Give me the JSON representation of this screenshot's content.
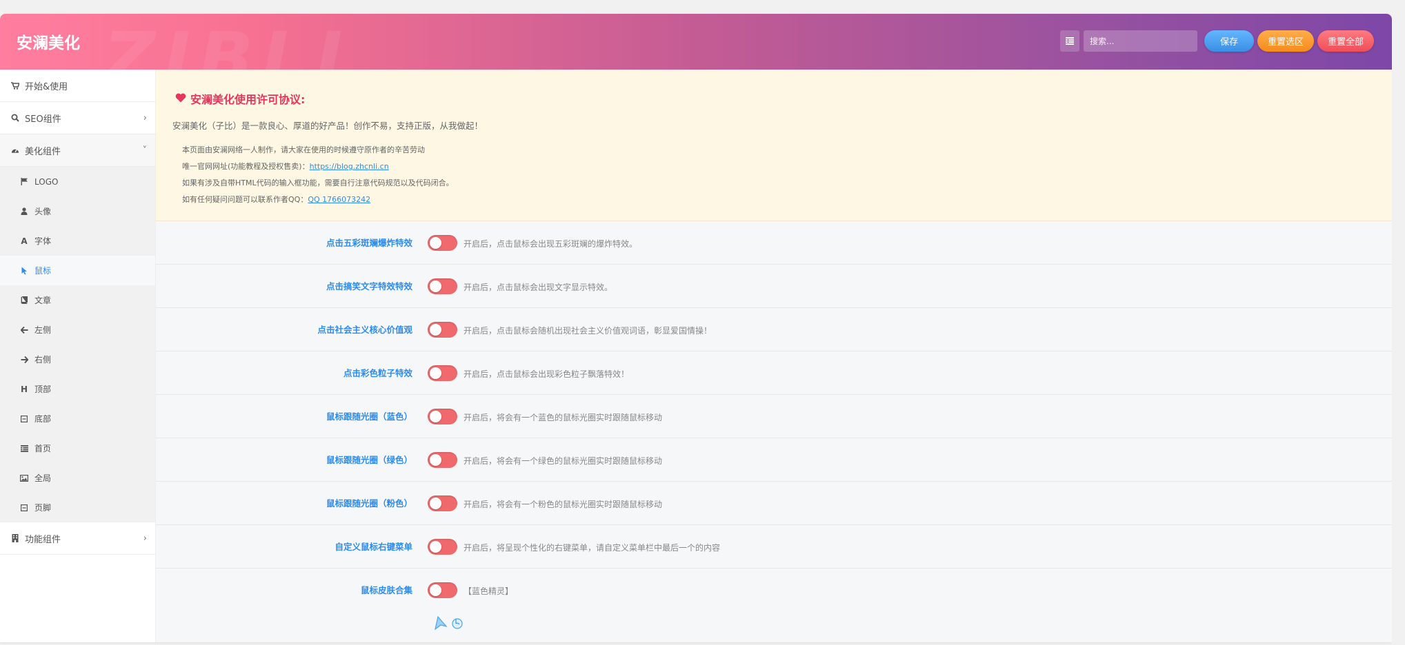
{
  "header": {
    "title": "安澜美化",
    "watermark": "ZIBLL",
    "search_placeholder": "搜索...",
    "save_label": "保存",
    "reset_section_label": "重置选区",
    "reset_all_label": "重置全部"
  },
  "sidebar": {
    "top_items": [
      {
        "label": "开始&使用",
        "icon": "cart-icon"
      },
      {
        "label": "SEO组件",
        "icon": "search-icon",
        "chevron": "›"
      },
      {
        "label": "美化组件",
        "icon": "dashboard-icon",
        "chevron": "˅"
      }
    ],
    "sub_items": [
      {
        "label": "LOGO",
        "icon": "flag-icon"
      },
      {
        "label": "头像",
        "icon": "user-icon"
      },
      {
        "label": "字体",
        "icon": "font-icon",
        "glyph": "A"
      },
      {
        "label": "鼠标",
        "icon": "cursor-icon",
        "active": true
      },
      {
        "label": "文章",
        "icon": "book-icon"
      },
      {
        "label": "左侧",
        "icon": "arrow-left-icon"
      },
      {
        "label": "右侧",
        "icon": "arrow-right-icon"
      },
      {
        "label": "顶部",
        "icon": "header-icon",
        "glyph": "H"
      },
      {
        "label": "底部",
        "icon": "minus-square-icon"
      },
      {
        "label": "首页",
        "icon": "list-icon"
      },
      {
        "label": "全局",
        "icon": "image-icon"
      },
      {
        "label": "页脚",
        "icon": "minus-square-icon"
      }
    ],
    "bottom_items": [
      {
        "label": "功能组件",
        "icon": "building-icon",
        "chevron": "›"
      }
    ]
  },
  "notice": {
    "title": "安澜美化使用许可协议:",
    "intro": "安澜美化（子比）是一款良心、厚道的好产品！创作不易，支持正版，从我做起！",
    "line1": "本页面由安澜网络一人制作，请大家在使用的时候遵守原作者的辛苦劳动",
    "line2_prefix": "唯一官网网址(功能教程及授权售卖)：",
    "line2_link": "https://blog.zhcnli.cn",
    "line3": "如果有涉及自带HTML代码的输入框功能，需要自行注意代码规范以及代码闭合。",
    "line4_prefix": "如有任何疑问问题可以联系作者QQ：",
    "line4_link": "QQ 1766073242"
  },
  "options": [
    {
      "label": "点击五彩斑斓爆炸特效",
      "desc": "开启后，点击鼠标会出现五彩斑斓的爆炸特效。",
      "enabled": false
    },
    {
      "label": "点击搞笑文字特效特效",
      "desc": "开启后，点击鼠标会出现文字显示特效。",
      "enabled": false
    },
    {
      "label": "点击社会主义核心价值观",
      "desc": "开启后，点击鼠标会随机出现社会主义价值观词语，彰显爱国情操！",
      "enabled": false
    },
    {
      "label": "点击彩色粒子特效",
      "desc": "开启后，点击鼠标会出现彩色粒子飘落特效！",
      "enabled": false
    },
    {
      "label": "鼠标跟随光圈（蓝色）",
      "desc": "开启后，将会有一个蓝色的鼠标光圈实时跟随鼠标移动",
      "enabled": false
    },
    {
      "label": "鼠标跟随光圈（绿色）",
      "desc": "开启后，将会有一个绿色的鼠标光圈实时跟随鼠标移动",
      "enabled": false
    },
    {
      "label": "鼠标跟随光圈（粉色）",
      "desc": "开启后，将会有一个粉色的鼠标光圈实时跟随鼠标移动",
      "enabled": false
    },
    {
      "label": "自定义鼠标右键菜单",
      "desc": "开启后，将呈现个性化的右键菜单，请自定义菜单栏中最后一个的内容",
      "enabled": false
    },
    {
      "label": "鼠标皮肤合集",
      "desc": "【蓝色精灵】",
      "enabled": false
    }
  ],
  "colors": {
    "accent": "#2d8cf0",
    "switch_off": "#f06a6d",
    "notice_bg": "#fdf7e4",
    "notice_title": "#e6375a"
  }
}
